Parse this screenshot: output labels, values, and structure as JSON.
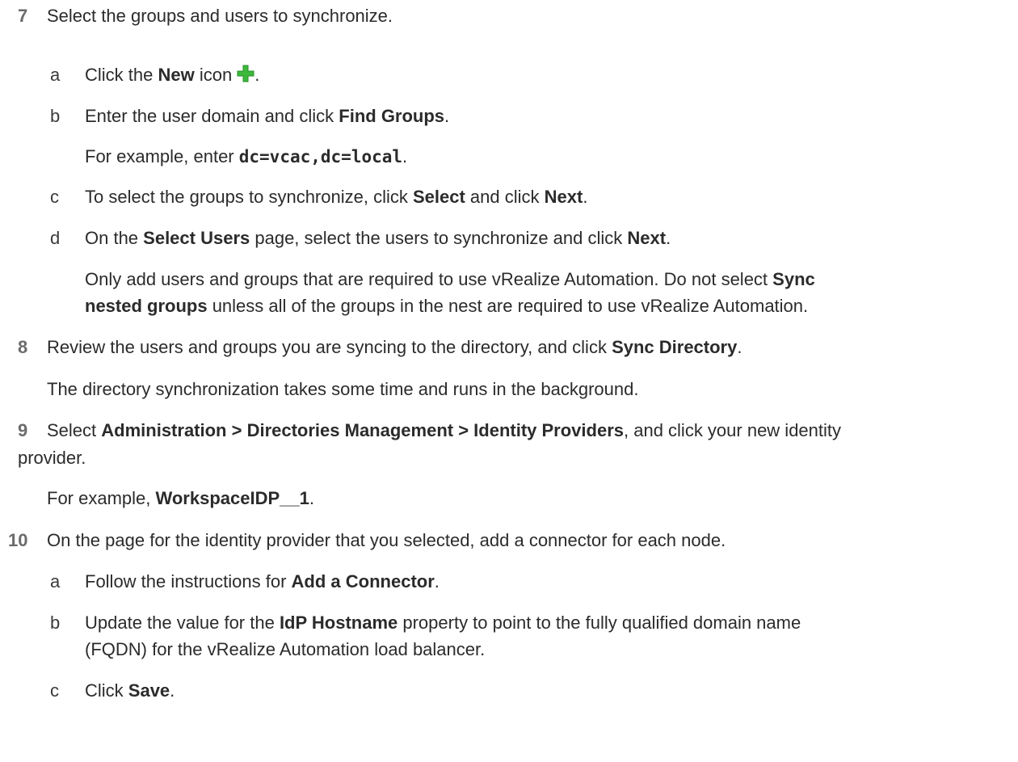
{
  "step7": {
    "number": "7",
    "text": "Select the groups and users to synchronize.",
    "sub_a": {
      "letter": "a",
      "pre": "Click the ",
      "bold": "New",
      "post": " icon",
      "icon": "green-plus-icon",
      "end": "."
    },
    "sub_b": {
      "letter": "b",
      "pre": "Enter the user domain and click ",
      "bold": "Find Groups",
      "post": "."
    },
    "sub_b_example": {
      "pre": "For example, enter ",
      "code": "dc=vcac,dc=local",
      "post": "."
    },
    "sub_c": {
      "letter": "c",
      "pre": "To select the groups to synchronize, click ",
      "bold1": "Select",
      "mid": " and click ",
      "bold2": "Next",
      "post": "."
    },
    "sub_d": {
      "letter": "d",
      "pre": "On the ",
      "bold1": "Select Users",
      "mid": " page, select the users to synchronize and click ",
      "bold2": "Next",
      "post": "."
    },
    "note_line1_pre": "Only add users and groups that are required to use vRealize Automation. Do not select ",
    "note_line1_bold": "Sync",
    "note_line2_bold": "nested groups",
    "note_line2_post": " unless all of the groups in the nest are required to use vRealize Automation."
  },
  "step8": {
    "number": "8",
    "pre": "Review the users and groups you are syncing to the directory, and click ",
    "bold": "Sync Directory",
    "post": ".",
    "note": "The directory synchronization takes some time and runs in the background."
  },
  "step9": {
    "number": "9",
    "pre": "Select ",
    "bold": "Administration > Directories Management > Identity Providers",
    "post": ", and click your new identity",
    "line2": "provider.",
    "example_pre": "For example, ",
    "example_bold": "WorkspaceIDP__1",
    "example_post": "."
  },
  "step10": {
    "number": "10",
    "text": "On the page for the identity provider that you selected, add a connector for each node.",
    "sub_a": {
      "letter": "a",
      "pre": "Follow the instructions for ",
      "bold": "Add a Connector",
      "post": "."
    },
    "sub_b": {
      "letter": "b",
      "pre": "Update the value for the ",
      "bold": "IdP Hostname",
      "post": " property to point to the fully qualified domain name",
      "line2": "(FQDN) for the vRealize Automation load balancer."
    },
    "sub_c": {
      "letter": "c",
      "pre": "Click ",
      "bold": "Save",
      "post": "."
    }
  },
  "colors": {
    "plus_icon": "#3cb83c",
    "step_number": "#6b6b6b",
    "text": "#2b2b2b"
  }
}
